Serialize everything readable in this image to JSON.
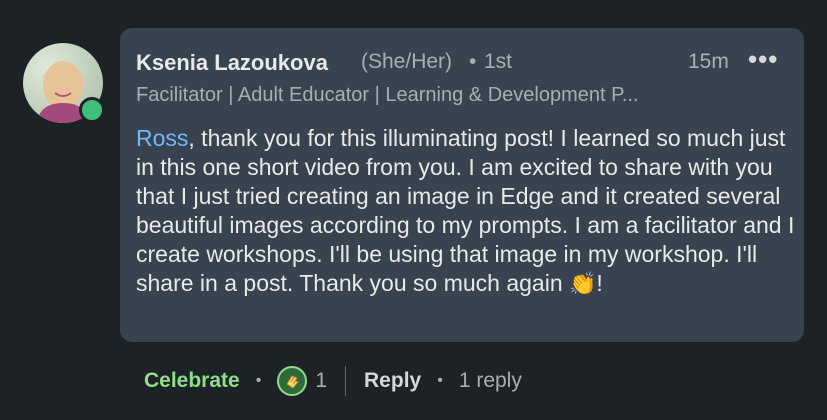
{
  "comment": {
    "author_name": "Ksenia Lazoukova",
    "pronouns": "(She/Her)",
    "separator": "•",
    "connection_degree": "1st",
    "time_ago": "15m",
    "more_label": "•••",
    "headline": "Facilitator | Adult Educator | Learning & Development P...",
    "mention": "Ross",
    "text_main": ", thank you for this illuminating post! I learned so much just in this one short video from you. I am excited to share with you that I just tried creating an image in Edge and it created several beautiful images according to my prompts. I am a facilitator and I create workshops. I'll be using that image in my workshop. I'll share in a post. Thank you so much again ",
    "text_emoji": "👏",
    "text_end": "!"
  },
  "actions": {
    "celebrate_label": "Celebrate",
    "bullet": "•",
    "reaction_icon": "clapping-hands-icon",
    "reaction_count": "1",
    "reply_label": "Reply",
    "replies_label": "1 reply"
  },
  "colors": {
    "background": "#1d2226",
    "bubble": "#38434f",
    "mention": "#71b7fb",
    "celebrate": "#8fdc8a",
    "online": "#3fbf77"
  }
}
